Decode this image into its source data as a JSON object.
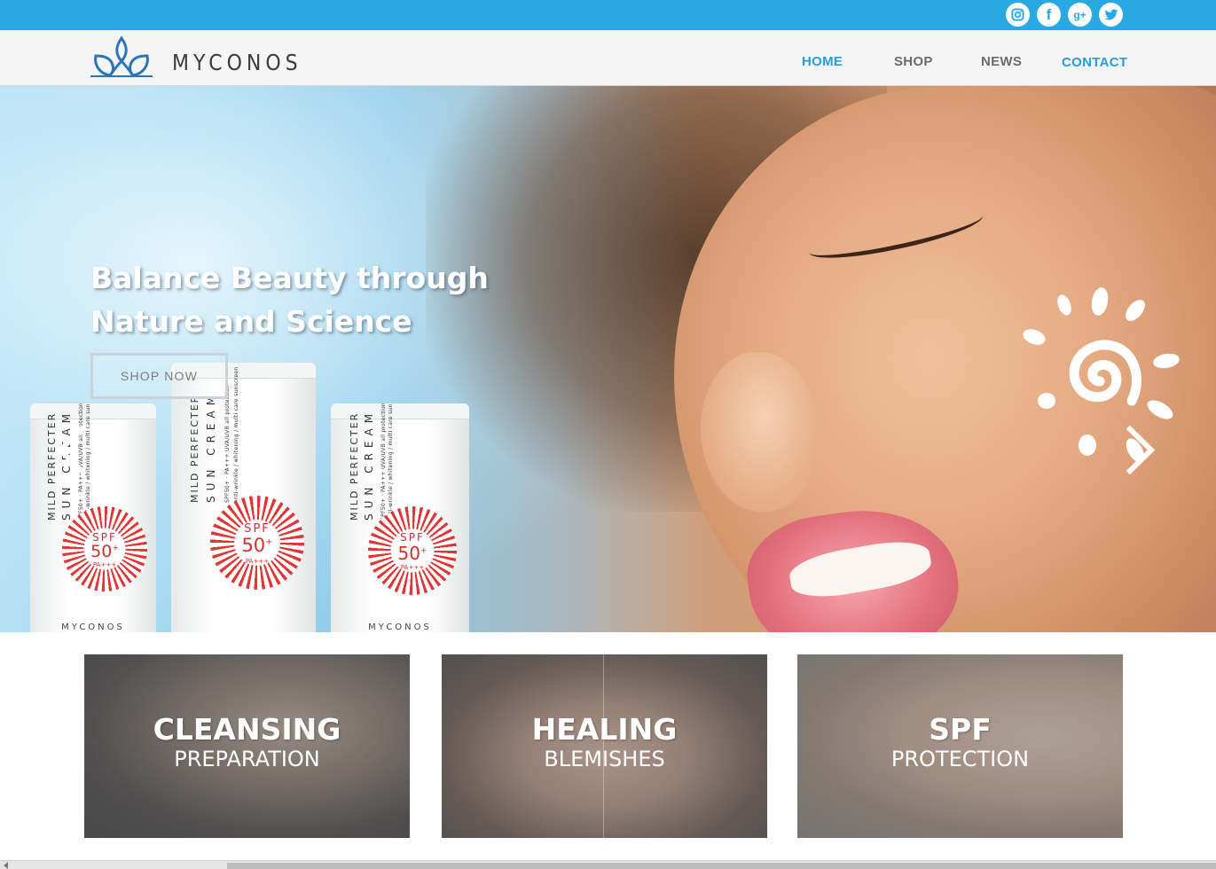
{
  "social": [
    {
      "name": "instagram",
      "icon": "instagram-icon"
    },
    {
      "name": "facebook",
      "icon": "facebook-icon",
      "glyph": "f"
    },
    {
      "name": "google-plus",
      "icon": "google-plus-icon",
      "glyph": "g+"
    },
    {
      "name": "twitter",
      "icon": "twitter-icon"
    }
  ],
  "brand": {
    "name": "MYCONOS",
    "logo_icon": "lotus-icon"
  },
  "nav": {
    "home": "HOME",
    "shop": "SHOP",
    "news": "NEWS",
    "contact": "CONTACT"
  },
  "hero": {
    "title_line1": "Balance Beauty through",
    "title_line2": "Nature and Science",
    "cta": "SHOP NOW",
    "prev_icon": "chevron-left-icon",
    "next_icon": "chevron-right-icon"
  },
  "products": {
    "name": "MILD PERFECTER",
    "sub": "SUN CREAM",
    "line1": "SPF50+ · PA+++ UVA/UVB all protection",
    "line2": "anti-wrinkle / whitening / multi care sunscreen",
    "spf_label": "SPF",
    "spf_value": "50",
    "spf_plus": "+",
    "pa": "PA+++",
    "brand": "MYCONOS"
  },
  "cards": [
    {
      "title": "CLEANSING",
      "subtitle": "PREPARATION"
    },
    {
      "title": "HEALING",
      "subtitle": "BLEMISHES"
    },
    {
      "title": "SPF",
      "subtitle": "PROTECTION"
    }
  ],
  "colors": {
    "accent": "#29a9e1",
    "nav_active": "#2b9bd6",
    "nav_default": "#6b6b6b",
    "header_bg": "#f5f5f5"
  }
}
